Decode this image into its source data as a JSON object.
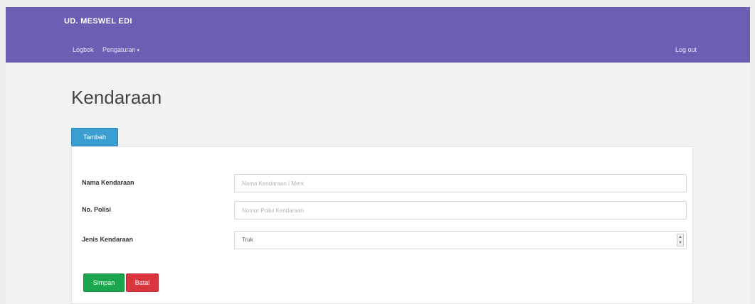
{
  "navbar": {
    "brand": "UD. MESWEL EDI",
    "links": [
      {
        "label": "Logbok"
      },
      {
        "label": "Pengaturan"
      }
    ],
    "logout_label": "Log out"
  },
  "page": {
    "title": "Kendaraan",
    "tab_label": "Tambah"
  },
  "form": {
    "fields": [
      {
        "label": "Nama Kendaraan",
        "placeholder": "Nama Kendaraan / Merk"
      },
      {
        "label": "No. Polisi",
        "placeholder": "Nomor Polisi Kendaraan"
      },
      {
        "label": "Jenis Kendaraan",
        "selected": "Truk"
      }
    ],
    "save_label": "Simpan",
    "cancel_label": "Batal"
  },
  "colors": {
    "navbar": "#6a5fb3",
    "tab": "#3b9ed3",
    "save": "#1aa54e",
    "cancel": "#d9363e"
  },
  "icons": {
    "dropdown_caret": "chevron-down-icon",
    "select_arrows": "select-arrows-icon"
  }
}
